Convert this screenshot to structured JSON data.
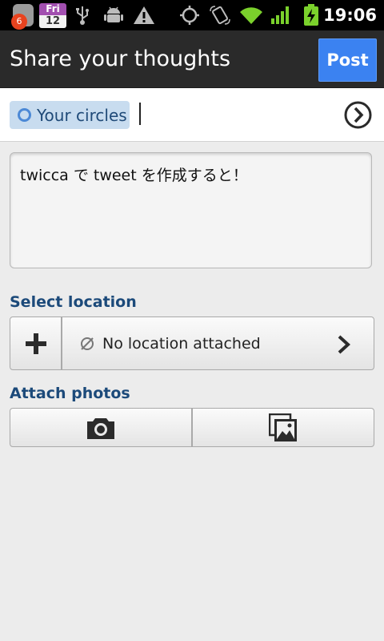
{
  "status_bar": {
    "notification_count": "6",
    "calendar_day": "Fri",
    "calendar_date": "12",
    "time": "19:06",
    "icons": [
      "notification-app-icon",
      "calendar-icon",
      "usb-icon",
      "android-debug-icon",
      "warning-icon",
      "gps-icon",
      "rotate-icon",
      "wifi-icon",
      "signal-icon",
      "battery-charging-icon"
    ]
  },
  "header": {
    "title": "Share your thoughts",
    "post_label": "Post"
  },
  "audience": {
    "chip_label": "Your circles"
  },
  "compose": {
    "text": "twicca で tweet を作成すると！"
  },
  "location": {
    "section_label": "Select location",
    "status_text": "No location attached"
  },
  "photos": {
    "section_label": "Attach photos"
  },
  "colors": {
    "accent": "#3b82f1",
    "section_label": "#1c4a7a",
    "chip_bg": "#c8dcef"
  }
}
